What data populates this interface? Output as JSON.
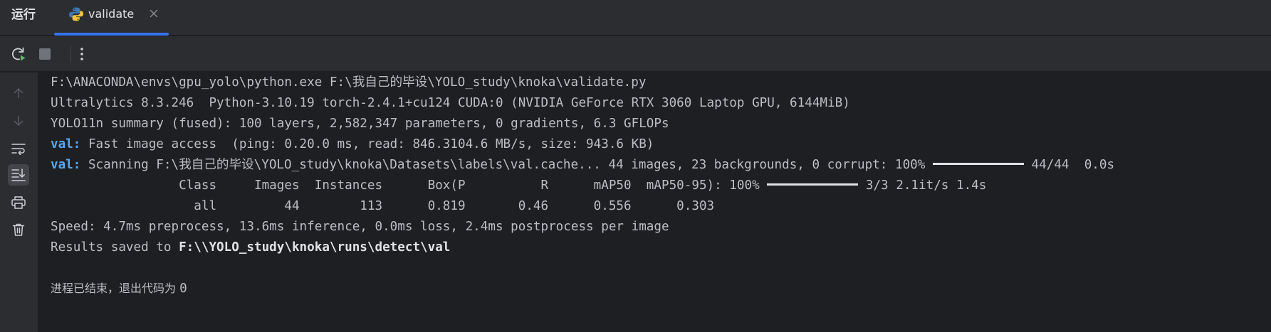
{
  "header": {
    "panel_title": "运行",
    "tab": {
      "label": "validate",
      "icon": "python-icon"
    }
  },
  "colors": {
    "accent": "#3574f0",
    "keyword": "#56a8f5",
    "run_green": "#5fb865",
    "background": "#1e1f22",
    "panel": "#2b2d30"
  },
  "toolbar": {
    "buttons": [
      "rerun-icon",
      "stop-icon",
      "more-options-icon"
    ]
  },
  "gutter": {
    "buttons": [
      "arrow-up-icon",
      "arrow-down-icon",
      "soft-wrap-icon",
      "scroll-to-end-icon",
      "print-icon",
      "trash-icon"
    ]
  },
  "console": {
    "line1": "F:\\ANACONDA\\envs\\gpu_yolo\\python.exe F:\\我自己的毕设\\YOLO_study\\knoka\\validate.py",
    "line2": "Ultralytics 8.3.246  Python-3.10.19 torch-2.4.1+cu124 CUDA:0 (NVIDIA GeForce RTX 3060 Laptop GPU, 6144MiB)",
    "line3": "YOLO11n summary (fused): 100 layers, 2,582,347 parameters, 0 gradients, 6.3 GFLOPs",
    "line4": {
      "prefix": "val:",
      "text": " Fast image access  (ping: 0.20.0 ms, read: 846.3104.6 MB/s, size: 943.6 KB)"
    },
    "line5": {
      "prefix": "val:",
      "text": " Scanning F:\\我自己的毕设\\YOLO_study\\knoka\\Datasets\\labels\\val.cache... 44 images, 23 backgrounds, 0 corrupt: 100% ",
      "progress_percent": 100,
      "suffix": " 44/44  0.0s"
    },
    "line6": {
      "text": "                 Class     Images  Instances      Box(P          R      mAP50  mAP50-95): 100% ",
      "progress_percent": 100,
      "suffix": " 3/3 2.1it/s 1.4s"
    },
    "line7": "                   all         44        113      0.819       0.46      0.556      0.303",
    "line8": "Speed: 4.7ms preprocess, 13.6ms inference, 0.0ms loss, 2.4ms postprocess per image",
    "line9": {
      "text": "Results saved to ",
      "path": "F:\\\\YOLO_study\\knoka\\runs\\detect\\val"
    },
    "exit_message": {
      "text": "进程已结束，退出代码为 ",
      "code": "0"
    }
  }
}
